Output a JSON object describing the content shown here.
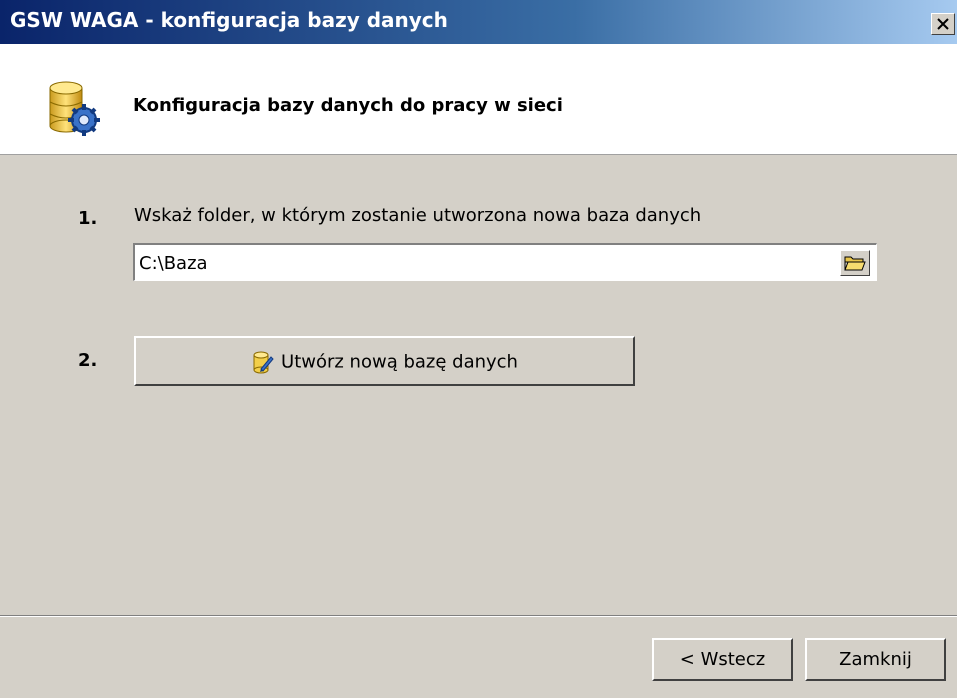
{
  "window": {
    "title": "GSW WAGA - konfiguracja bazy danych",
    "close_glyph": "×"
  },
  "header": {
    "title": "Konfiguracja bazy danych do pracy w sieci",
    "icon": "database-gear-icon"
  },
  "step1": {
    "number": "1.",
    "label": "Wskaż folder, w którym zostanie utworzona nowa baza danych",
    "path_value": "C:\\Baza",
    "browse_icon": "folder-open-icon"
  },
  "step2": {
    "number": "2.",
    "button_label": "Utwórz nową bazę danych",
    "button_icon": "database-create-icon"
  },
  "footer": {
    "back_label": "< Wstecz",
    "close_label": "Zamknij"
  },
  "colors": {
    "title_gradient_start": "#0a246a",
    "title_gradient_end": "#a6caf0",
    "dialog_bg": "#d4d0c8"
  }
}
